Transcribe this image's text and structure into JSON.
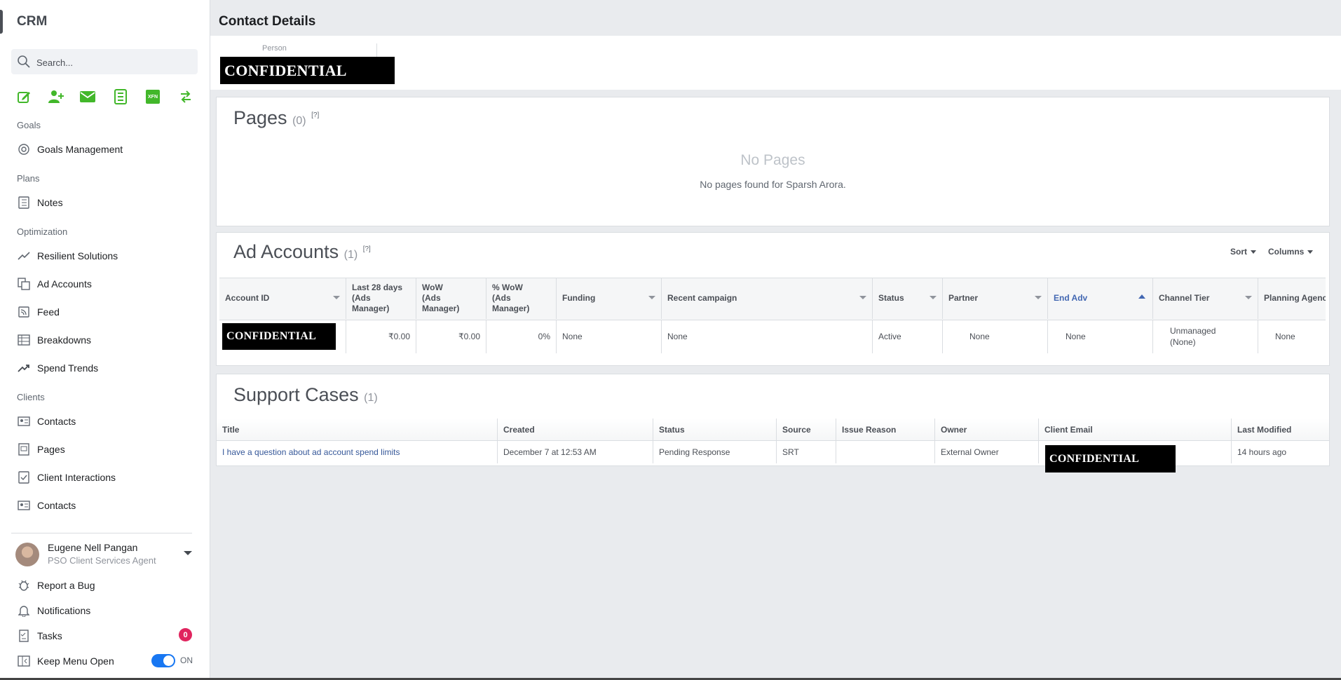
{
  "sidebar": {
    "brand": "CRM",
    "search_placeholder": "Search...",
    "quick_actions": [
      "edit-icon",
      "add-person-icon",
      "mail-icon",
      "spreadsheet-icon",
      "xfn-icon",
      "swap-icon"
    ],
    "xfn_label": "XFN",
    "sections": {
      "goals": "Goals",
      "plans": "Plans",
      "optimization": "Optimization",
      "clients": "Clients"
    },
    "items": {
      "goals_management": "Goals Management",
      "notes": "Notes",
      "resilient_solutions": "Resilient Solutions",
      "ad_accounts": "Ad Accounts",
      "feed": "Feed",
      "breakdowns": "Breakdowns",
      "spend_trends": "Spend Trends",
      "contacts": "Contacts",
      "pages": "Pages",
      "client_interactions": "Client Interactions",
      "contacts_2": "Contacts"
    },
    "user": {
      "name": "Eugene Nell Pangan",
      "role": "PSO Client Services Agent"
    },
    "footer": {
      "report_bug": "Report a Bug",
      "notifications": "Notifications",
      "tasks": "Tasks",
      "tasks_count": "0",
      "keep_menu_open": "Keep Menu Open",
      "toggle_state": "ON"
    }
  },
  "main": {
    "title": "Contact Details",
    "person_label": "Person",
    "redacted_text": "CONFIDENTIAL",
    "pages": {
      "title": "Pages",
      "count": "(0)",
      "help": "[?]",
      "empty_title": "No Pages",
      "empty_text": "No pages found for Sparsh Arora."
    },
    "ad_accounts": {
      "title": "Ad Accounts",
      "count": "(1)",
      "help": "[?]",
      "sort_label": "Sort",
      "columns_label": "Columns",
      "headers": {
        "account_id": "Account ID",
        "last28": "Last 28 days\n(Ads Manager)",
        "wow": "WoW\n(Ads Manager)",
        "pct_wow": "% WoW\n(Ads Manager)",
        "funding": "Funding",
        "recent_campaign": "Recent campaign",
        "status": "Status",
        "partner": "Partner",
        "end_adv": "End Adv",
        "channel_tier": "Channel Tier",
        "planning_agency": "Planning Agenc"
      },
      "row": {
        "last28": "₹0.00",
        "wow": "₹0.00",
        "pct_wow": "0%",
        "funding": "None",
        "recent_campaign": "None",
        "status": "Active",
        "partner": "None",
        "end_adv": "None",
        "channel_tier": "Unmanaged\n(None)",
        "planning_agency": "None"
      }
    },
    "support_cases": {
      "title": "Support Cases",
      "count": "(1)",
      "headers": {
        "title": "Title",
        "created": "Created",
        "status": "Status",
        "source": "Source",
        "issue_reason": "Issue Reason",
        "owner": "Owner",
        "client_email": "Client Email",
        "last_modified": "Last Modified"
      },
      "row": {
        "title": "I have a question about ad account spend limits",
        "created": "December 7 at 12:53 AM",
        "status": "Pending Response",
        "source": "SRT",
        "issue_reason": "",
        "owner": "External Owner",
        "last_modified": "14 hours ago"
      }
    }
  },
  "colors": {
    "accent": "#1877f2",
    "link": "#365899",
    "icon_green": "#42b72a",
    "badge": "#e0245e"
  }
}
